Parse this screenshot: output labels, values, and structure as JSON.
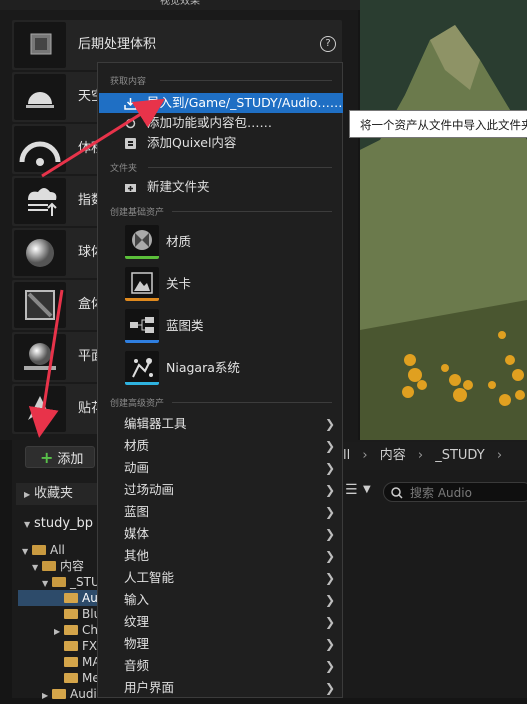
{
  "top_title": "视觉效果",
  "left_panel": {
    "items": [
      {
        "label": "后期处理体积",
        "icon": "post-process-volume-icon"
      },
      {
        "label": "天空",
        "icon": "sky-light-icon"
      },
      {
        "label": "体积",
        "icon": "volumetric-cloud-icon"
      },
      {
        "label": "指数",
        "icon": "exponential-fog-icon"
      },
      {
        "label": "球体",
        "icon": "sphere-reflection-icon"
      },
      {
        "label": "盒体",
        "icon": "box-reflection-icon"
      },
      {
        "label": "平面",
        "icon": "planar-reflection-icon"
      },
      {
        "label": "贴花",
        "icon": "decal-icon"
      }
    ],
    "help": "?"
  },
  "tooltip": "将一个资产从文件中导入此文件夹",
  "menu": {
    "section_get": "获取内容",
    "import": "导入到/Game/_STUDY/Audio……",
    "add_feature": "添加功能或内容包……",
    "add_quixel": "添加Quixel内容",
    "section_folder": "文件夹",
    "new_folder": "新建文件夹",
    "section_basic": "创建基础资产",
    "basic_assets": [
      {
        "label": "材质",
        "color": "#5bbf3a"
      },
      {
        "label": "关卡",
        "color": "#e08a1e"
      },
      {
        "label": "蓝图类",
        "color": "#2f7fe0"
      },
      {
        "label": "Niagara系统",
        "color": "#2fb3e0"
      }
    ],
    "section_advanced": "创建高级资产",
    "advanced": [
      "编辑器工具",
      "材质",
      "动画",
      "过场动画",
      "蓝图",
      "媒体",
      "其他",
      "人工智能",
      "输入",
      "纹理",
      "物理",
      "音频",
      "用户界面"
    ]
  },
  "content_browser": {
    "add_label": "添加",
    "favorites": "收藏夹",
    "project": "study_bp",
    "tree": [
      "All",
      "内容",
      "_STUDY",
      "Audio",
      "Blu",
      "Ch",
      "FX",
      "MA",
      "Me",
      "Audi"
    ],
    "breadcrumb": [
      "ll",
      "内容",
      "_STUDY"
    ],
    "search_placeholder": "搜索 Audio"
  }
}
